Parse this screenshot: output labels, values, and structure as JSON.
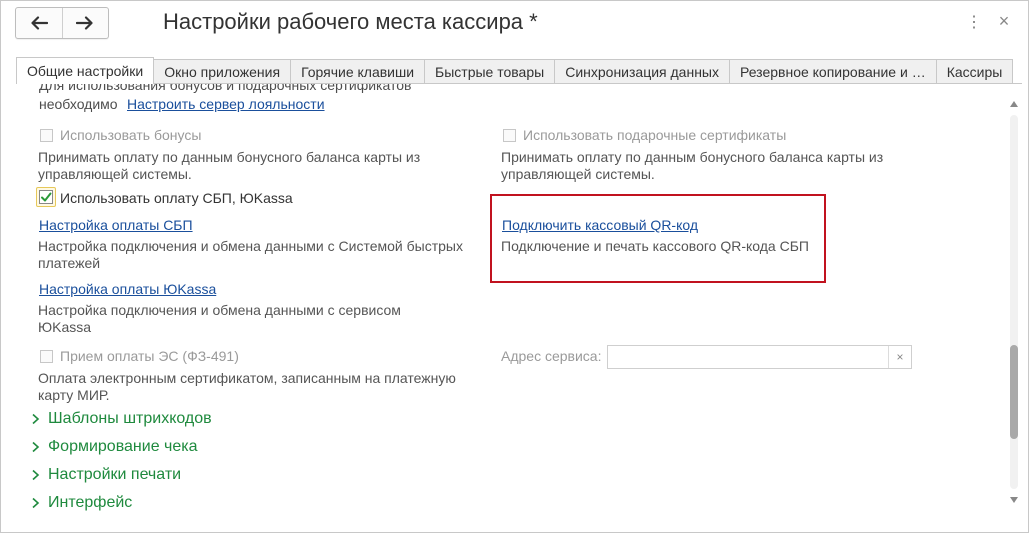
{
  "header": {
    "title": "Настройки рабочего места кассира *",
    "back_icon": "arrow-left-icon",
    "forward_icon": "arrow-right-icon",
    "more_icon": "more-vertical-icon",
    "more_glyph": "⋮",
    "close_icon": "close-icon",
    "close_glyph": "×"
  },
  "tabs": [
    {
      "label": "Общие настройки",
      "active": true
    },
    {
      "label": "Окно приложения",
      "active": false
    },
    {
      "label": "Горячие клавиши",
      "active": false
    },
    {
      "label": "Быстрые товары",
      "active": false
    },
    {
      "label": "Синхронизация данных",
      "active": false
    },
    {
      "label": "Резервное копирование и …",
      "active": false
    },
    {
      "label": "Кассиры",
      "active": false
    }
  ],
  "content": {
    "cut_text": "Для использования бонусов и подарочных сертификатов",
    "loyalty_prefix": "необходимо",
    "loyalty_link": "Настроить сервер лояльности",
    "bonuses": {
      "label": "Использовать бонусы",
      "checked": false,
      "desc": "Принимать оплату по данным бонусного баланса карты из управляющей системы."
    },
    "gift": {
      "label": "Использовать подарочные сертификаты",
      "checked": false,
      "desc": "Принимать оплату по данным бонусного баланса карты из управляющей системы."
    },
    "sbp": {
      "label": "Использовать оплату СБП, ЮKassa",
      "checked": true,
      "link": "Настройка оплаты СБП",
      "desc": "Настройка подключения и обмена данными с Системой быстрых платежей"
    },
    "qr": {
      "link": "Подключить кассовый QR-код",
      "desc": "Подключение и печать кассового QR-кода СБП"
    },
    "yookassa": {
      "link": "Настройка оплаты ЮKassa",
      "desc": "Настройка подключения и обмена данными с сервисом ЮKassa"
    },
    "es": {
      "label": "Прием оплаты ЭС (ФЗ-491)",
      "checked": false,
      "desc": "Оплата электронным сертификатом, записанным на платежную карту МИР."
    },
    "service": {
      "label": "Адрес сервиса:",
      "value": "",
      "placeholder": "",
      "clear_glyph": "×"
    },
    "sections": [
      {
        "label": "Шаблоны штрихкодов"
      },
      {
        "label": "Формирование чека"
      },
      {
        "label": "Настройки печати"
      },
      {
        "label": "Интерфейс"
      }
    ]
  },
  "scrollbar": {
    "position": 0.82,
    "visible_fraction": 0.25
  },
  "colors": {
    "link": "#1a4f9c",
    "section": "#1f8a3e",
    "highlight": "#c1121f"
  }
}
